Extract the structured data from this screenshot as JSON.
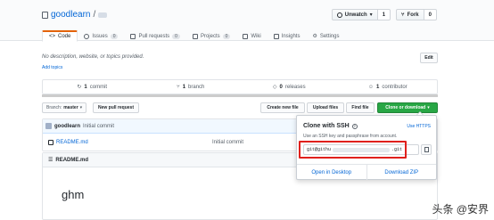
{
  "repo": {
    "owner": "goodlearn",
    "separator": "/"
  },
  "actions": {
    "unwatch_label": "Unwatch",
    "unwatch_count": "1",
    "fork_label": "Fork",
    "fork_count": "0"
  },
  "tabs": [
    {
      "label": "Code",
      "icon": "code-icon"
    },
    {
      "label": "Issues",
      "count": "0",
      "icon": "issue-icon"
    },
    {
      "label": "Pull requests",
      "count": "0",
      "icon": "pull-request-icon"
    },
    {
      "label": "Projects",
      "count": "0",
      "icon": "project-icon"
    },
    {
      "label": "Wiki",
      "icon": "wiki-icon"
    },
    {
      "label": "Insights",
      "icon": "graph-icon"
    },
    {
      "label": "Settings",
      "icon": "gear-icon"
    }
  ],
  "description": {
    "text": "No description, website, or topics provided.",
    "add_topics": "Add topics",
    "edit_label": "Edit"
  },
  "summary": [
    {
      "count": "1",
      "label": "commit",
      "icon": "history-icon"
    },
    {
      "count": "1",
      "label": "branch",
      "icon": "branch-icon"
    },
    {
      "count": "0",
      "label": "releases",
      "icon": "tag-icon"
    },
    {
      "count": "1",
      "label": "contributor",
      "icon": "people-icon"
    }
  ],
  "toolbar": {
    "branch_prefix": "Branch:",
    "branch_name": "master",
    "new_pr": "New pull request",
    "create_file": "Create new file",
    "upload_files": "Upload files",
    "find_file": "Find file",
    "clone": "Clone or download"
  },
  "commit": {
    "author": "goodlearn",
    "message": "Initial commit"
  },
  "files": [
    {
      "name": "README.md",
      "message": "Initial commit"
    }
  ],
  "readme": {
    "title": "README.md",
    "heading": "ghm"
  },
  "clone_popover": {
    "title": "Clone with SSH",
    "use_https": "Use HTTPS",
    "subtitle": "Use an SSH key and passphrase from account.",
    "url_start": "git@githu",
    "url_end": ".git",
    "open_desktop": "Open in Desktop",
    "download_zip": "Download ZIP"
  },
  "watermark": {
    "text": "头条 @安界"
  },
  "colors": {
    "accent_green": "#28a745",
    "link_blue": "#0366d6",
    "highlight_red": "#e0201c",
    "tab_orange": "#e36209"
  }
}
